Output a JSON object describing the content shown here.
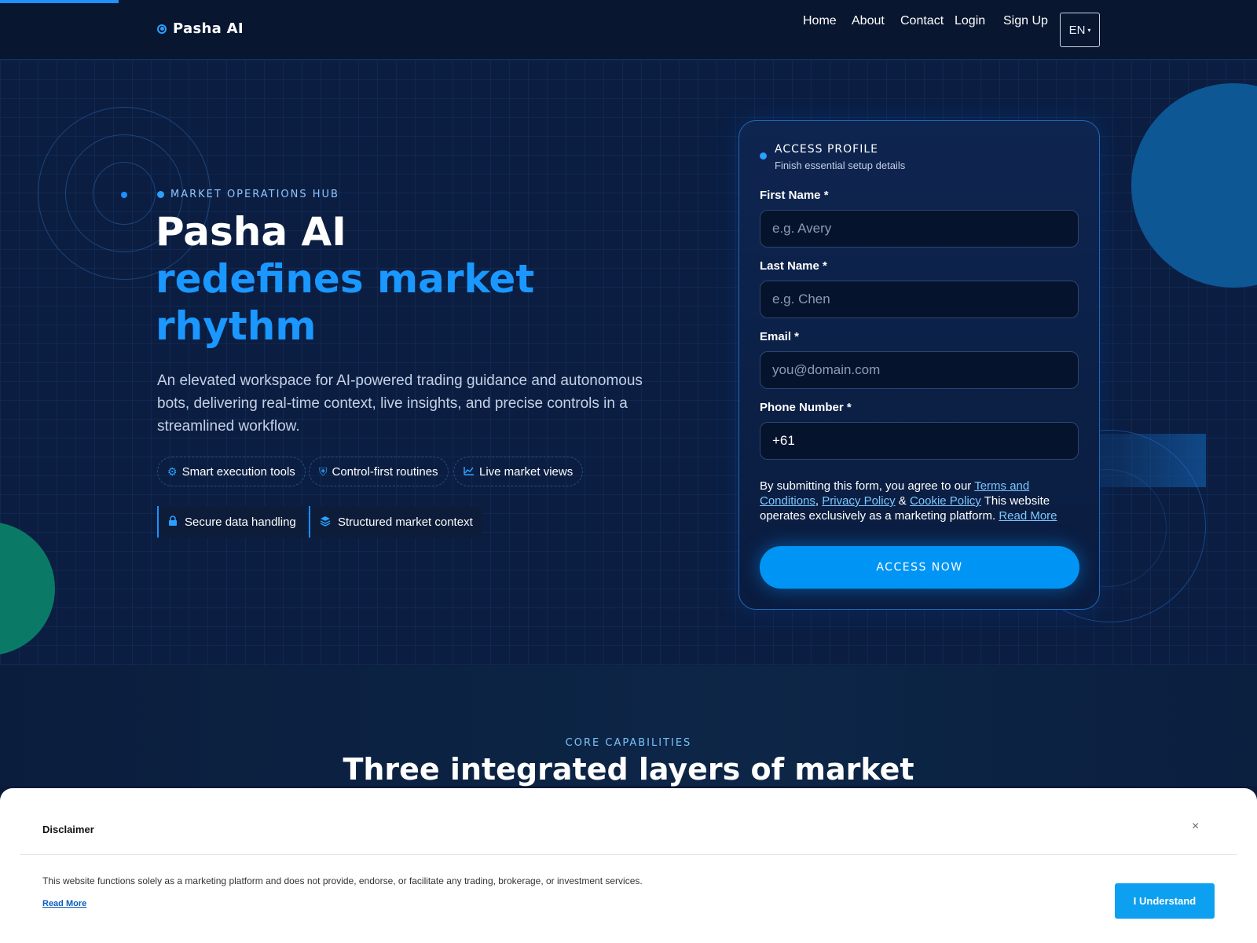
{
  "header": {
    "logo": "Pasha AI",
    "nav": [
      "Home",
      "About",
      "Contact",
      "Login",
      "Sign Up"
    ],
    "language": "EN"
  },
  "hero": {
    "kicker": "MARKET OPERATIONS HUB",
    "title_line1": "Pasha AI",
    "title_line2": "redefines market",
    "title_line3": "rhythm",
    "lede": "An elevated workspace for AI-powered trading guidance and autonomous bots, delivering real-time context, live insights, and precise controls in a streamlined workflow.",
    "chips": [
      {
        "icon": "chip-icon",
        "label": "Smart execution tools"
      },
      {
        "icon": "shield-icon",
        "label": "Control-first routines"
      },
      {
        "icon": "chart-icon",
        "label": "Live market views"
      }
    ],
    "tags": [
      {
        "icon": "lock-icon",
        "label": "Secure data handling"
      },
      {
        "icon": "layers-icon",
        "label": "Structured market context"
      }
    ]
  },
  "form": {
    "title": "ACCESS PROFILE",
    "subtitle": "Finish essential setup details",
    "first_name_label": "First Name *",
    "first_name_placeholder": "e.g. Avery",
    "last_name_label": "Last Name *",
    "last_name_placeholder": "e.g. Chen",
    "email_label": "Email *",
    "email_placeholder": "you@domain.com",
    "phone_label": "Phone Number *",
    "phone_value": "+61",
    "consent_prefix": "By submitting this form, you agree to our ",
    "terms_link": "Terms and Conditions",
    "comma": ", ",
    "privacy_link": "Privacy Policy",
    "amp": " & ",
    "cookie_link": "Cookie Policy",
    "consent_suffix": " This website operates exclusively as a marketing platform. ",
    "read_more_link": "Read More",
    "submit_label": "ACCESS NOW"
  },
  "core": {
    "kicker": "CORE CAPABILITIES",
    "title": "Three integrated layers of market"
  },
  "disclaimer": {
    "title": "Disclaimer",
    "close": "×",
    "text": "This website functions solely as a marketing platform and does not provide, endorse, or facilitate any trading, brokerage, or investment services.",
    "read_more": "Read More",
    "button": "I Understand"
  },
  "colors": {
    "accent": "#1a98ff",
    "background": "#0b1e42",
    "cta": "#0095f5"
  }
}
